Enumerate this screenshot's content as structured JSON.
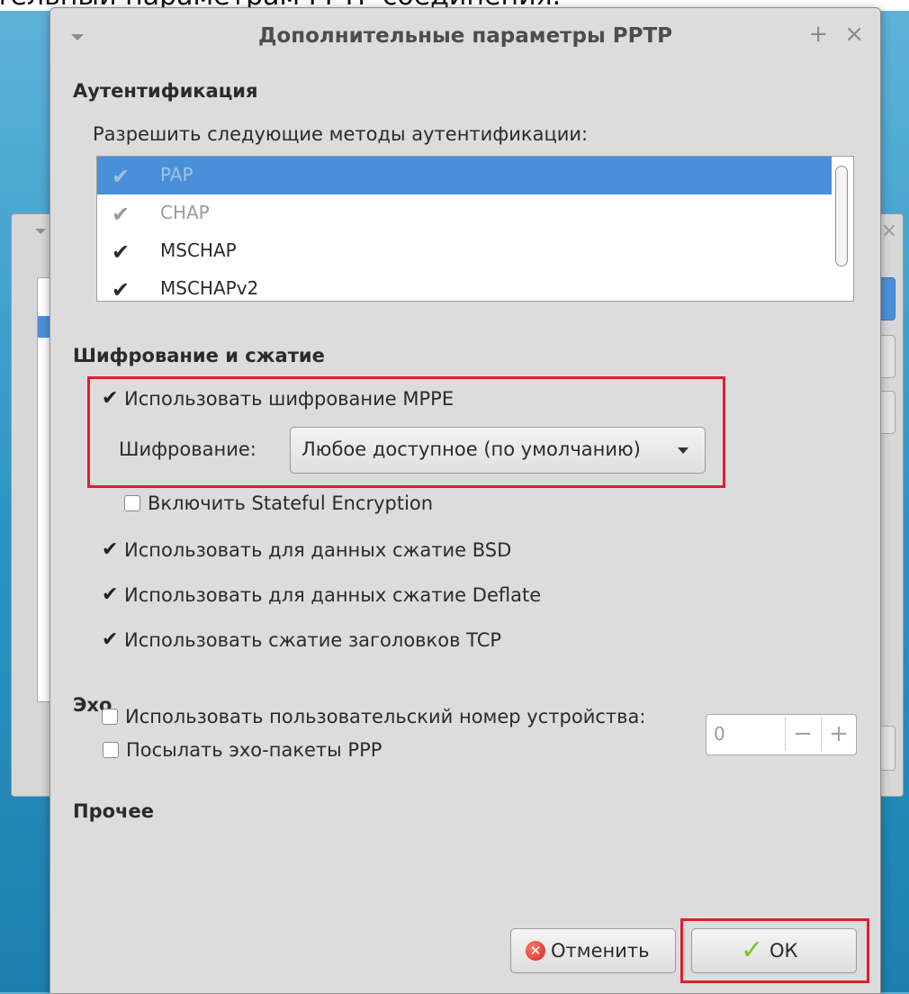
{
  "caption": "тельный параметрам РРТР соединения.",
  "dialog": {
    "title": "Дополнительные параметры PPTP",
    "plus_glyph": "+",
    "close_glyph": "×"
  },
  "auth": {
    "heading": "Аутентификация",
    "prompt": "Разрешить следующие методы аутентификации:",
    "methods": [
      {
        "label": "PAP",
        "checked": true,
        "selected": true
      },
      {
        "label": "CHAP",
        "checked": true,
        "selected": false
      },
      {
        "label": "MSCHAP",
        "checked": true,
        "selected": false
      },
      {
        "label": "MSCHAPv2",
        "checked": true,
        "selected": false
      }
    ]
  },
  "encryption": {
    "heading": "Шифрование и сжатие",
    "use_mppe": "Использовать шифрование MPPE",
    "cipher_label": "Шифрование:",
    "cipher_value": "Любое доступное (по умолчанию)",
    "stateful": "Включить Stateful Encryption",
    "bsd": "Использовать для данных сжатие BSD",
    "deflate": "Использовать для данных сжатие Deflate",
    "tcp": "Использовать сжатие заголовков TCP"
  },
  "echo": {
    "heading": "Эхо",
    "send_echo": "Посылать эхо-пакеты PPP"
  },
  "misc": {
    "heading": "Прочее",
    "custom_unit": "Использовать пользовательский номер устройства:",
    "unit_value": "0",
    "minus": "−",
    "plus": "+"
  },
  "buttons": {
    "cancel": "Отменить",
    "ok": "ОК"
  },
  "colors": {
    "highlight": "#e01e2e",
    "selection": "#4a90d9"
  }
}
